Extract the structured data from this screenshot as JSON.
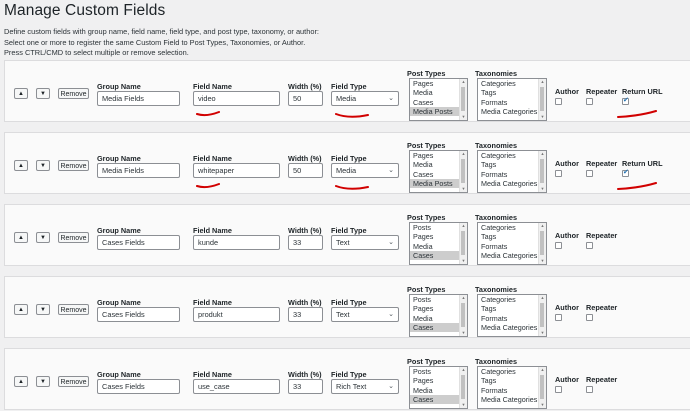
{
  "page": {
    "title": "Manage Custom Fields",
    "intro": [
      "Define custom fields with group name, field name, field type, and post type, taxonomy, or author:",
      "Select one or more to register the same Custom Field to Post Types, Taxonomies, or Author.",
      "Press CTRL/CMD to select multiple or remove selection."
    ]
  },
  "labels": {
    "group_name": "Group Name",
    "field_name": "Field Name",
    "width": "Width (%)",
    "field_type": "Field Type",
    "post_types": "Post Types",
    "taxonomies": "Taxonomies",
    "author": "Author",
    "repeater": "Repeater",
    "return_url": "Return URL",
    "remove": "Remove",
    "up": "▲",
    "down": "▼"
  },
  "icons": {
    "chevron": "chevron-down-icon",
    "checkmark": "checkmark-icon"
  },
  "colors": {
    "annotation": "#d10000",
    "checkbox_accent": "#2271b1"
  },
  "rows": [
    {
      "group_name": "Media Fields",
      "field_name": "video",
      "width": "50",
      "field_type": "Media",
      "post_types": [
        "Pages",
        "Media",
        "Cases",
        "Media Posts"
      ],
      "post_types_selected": "Media Posts",
      "taxonomies": [
        "Categories",
        "Tags",
        "Formats",
        "Media Categories"
      ],
      "author": false,
      "repeater": false,
      "has_return_url": true,
      "return_url": true,
      "annotated": true
    },
    {
      "group_name": "Media Fields",
      "field_name": "whitepaper",
      "width": "50",
      "field_type": "Media",
      "post_types": [
        "Pages",
        "Media",
        "Cases",
        "Media Posts"
      ],
      "post_types_selected": "Media Posts",
      "taxonomies": [
        "Categories",
        "Tags",
        "Formats",
        "Media Categories"
      ],
      "author": false,
      "repeater": false,
      "has_return_url": true,
      "return_url": true,
      "annotated": true
    },
    {
      "group_name": "Cases Fields",
      "field_name": "kunde",
      "width": "33",
      "field_type": "Text",
      "post_types": [
        "Posts",
        "Pages",
        "Media",
        "Cases"
      ],
      "post_types_selected": "Cases",
      "taxonomies": [
        "Categories",
        "Tags",
        "Formats",
        "Media Categories"
      ],
      "author": false,
      "repeater": false,
      "has_return_url": false,
      "return_url": false,
      "annotated": false
    },
    {
      "group_name": "Cases Fields",
      "field_name": "produkt",
      "width": "33",
      "field_type": "Text",
      "post_types": [
        "Posts",
        "Pages",
        "Media",
        "Cases"
      ],
      "post_types_selected": "Cases",
      "taxonomies": [
        "Categories",
        "Tags",
        "Formats",
        "Media Categories"
      ],
      "author": false,
      "repeater": false,
      "has_return_url": false,
      "return_url": false,
      "annotated": false
    },
    {
      "group_name": "Cases Fields",
      "field_name": "use_case",
      "width": "33",
      "field_type": "Rich Text",
      "post_types": [
        "Posts",
        "Pages",
        "Media",
        "Cases"
      ],
      "post_types_selected": "Cases",
      "taxonomies": [
        "Categories",
        "Tags",
        "Formats",
        "Media Categories"
      ],
      "author": false,
      "repeater": false,
      "has_return_url": false,
      "return_url": false,
      "annotated": false
    }
  ]
}
